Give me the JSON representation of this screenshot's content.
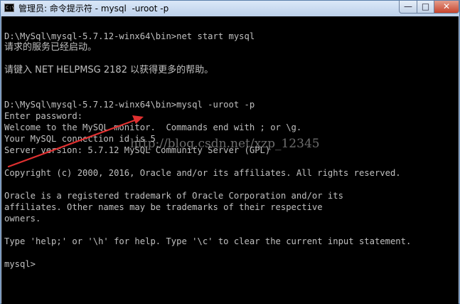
{
  "window": {
    "title": "管理员: 命令提示符 - mysql  -uroot -p",
    "icon_text": "C:\\",
    "controls": {
      "minimize": "—",
      "maximize": "□",
      "close": "✕"
    }
  },
  "console": {
    "lines": [
      "D:\\MySql\\mysql-5.7.12-winx64\\bin>net start mysql",
      "请求的服务已经启动。",
      "",
      "请键入 NET HELPMSG 2182 以获得更多的帮助。",
      "",
      "",
      "D:\\MySql\\mysql-5.7.12-winx64\\bin>mysql -uroot -p",
      "Enter password:",
      "Welcome to the MySQL monitor.  Commands end with ; or \\g.",
      "Your MySQL connection id is 5",
      "Server version: 5.7.12 MySQL Community Server (GPL)",
      "",
      "Copyright (c) 2000, 2016, Oracle and/or its affiliates. All rights reserved.",
      "",
      "Oracle is a registered trademark of Oracle Corporation and/or its",
      "affiliates. Other names may be trademarks of their respective",
      "owners.",
      "",
      "Type 'help;' or '\\h' for help. Type '\\c' to clear the current input statement.",
      "",
      "mysql>"
    ]
  },
  "watermark": "http://blog.csdn.net/xzp_12345",
  "colors": {
    "console_bg": "#000000",
    "console_text": "#c0c0c0",
    "annotation_arrow": "#e03030",
    "close_button": "#c8452e"
  }
}
